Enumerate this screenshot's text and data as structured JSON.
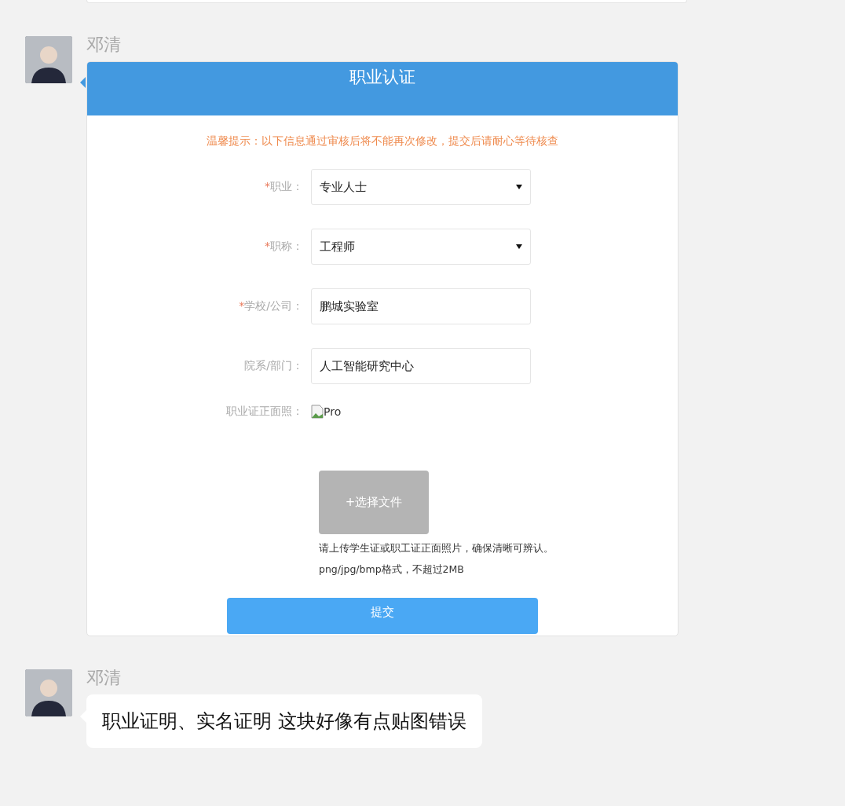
{
  "messages": [
    {
      "kind": "form-card",
      "sender": "邓清",
      "card": {
        "title": "职业认证",
        "notice": "温馨提示：以下信息通过审核后将不能再次修改，提交后请耐心等待核查",
        "fields": [
          {
            "kind": "select",
            "required_mark": "*",
            "label": "职业：",
            "value": "专业人士"
          },
          {
            "kind": "select",
            "required_mark": "*",
            "label": "职称：",
            "value": "工程师"
          },
          {
            "kind": "input",
            "required_mark": "*",
            "label": "学校/公司：",
            "value": "鹏城实验室"
          },
          {
            "kind": "input",
            "label": "院系/部门：",
            "value": "人工智能研究中心"
          },
          {
            "kind": "image",
            "label": "职业证正面照：",
            "alt": "Pro"
          }
        ],
        "upload_button": "+选择文件",
        "upload_hints": [
          "请上传学生证或职工证正面照片，确保清晰可辨认。",
          "png/jpg/bmp格式，不超过2MB"
        ],
        "submit": "提交"
      }
    },
    {
      "kind": "text",
      "sender": "邓清",
      "text": "职业证明、实名证明 这块好像有点贴图错误"
    }
  ]
}
